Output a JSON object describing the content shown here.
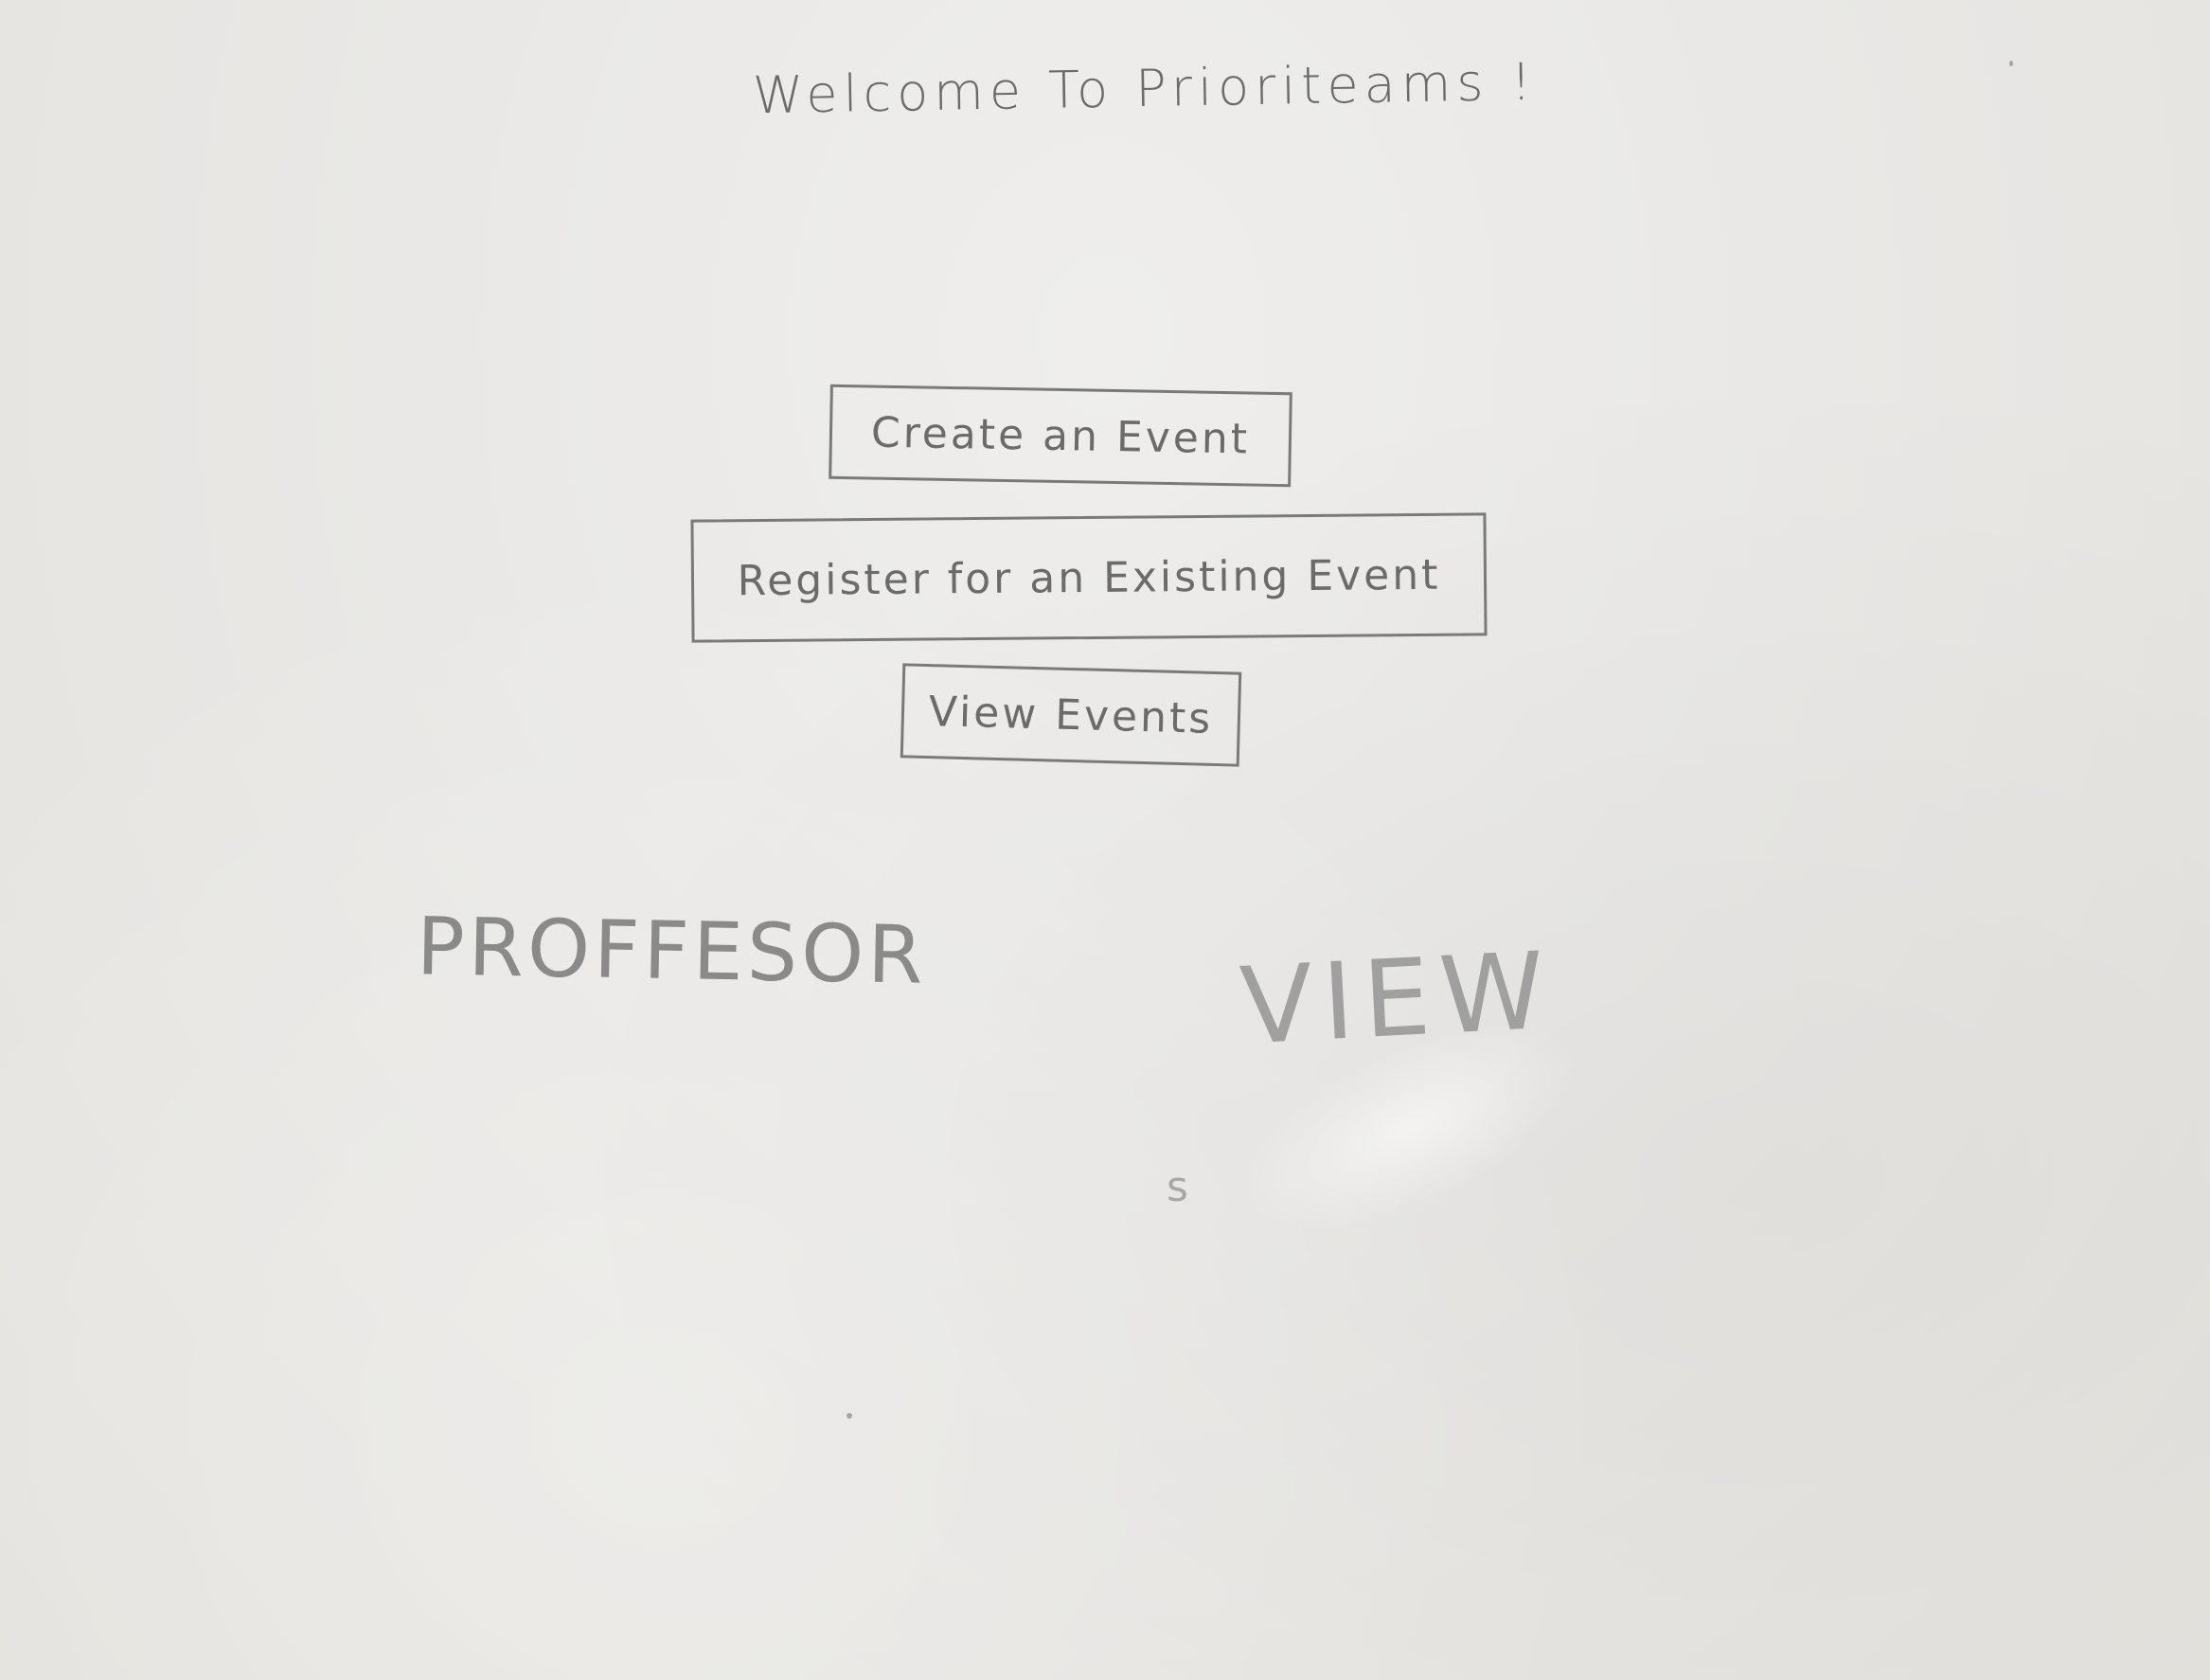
{
  "header": {
    "title": "Welcome To Prioriteams !"
  },
  "actions": {
    "create_label": "Create an Event",
    "register_label": "Register for an Existing Event",
    "view_label": "View Events"
  },
  "annotations": {
    "role_label": "PROFFESOR",
    "view_label": "VIEW",
    "stray_mark": "s"
  }
}
